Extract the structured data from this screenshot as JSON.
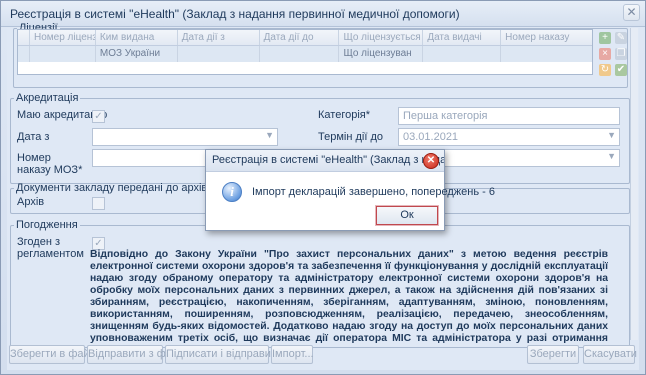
{
  "window": {
    "title": "Реєстрація в системі \"eHealth\" (Заклад з надання первинної медичної допомоги)",
    "close_glyph": "✕"
  },
  "licenses": {
    "legend": "Ліцензії",
    "columns": [
      "",
      "Номер ліцензії",
      "Ким видана",
      "Дата дії з",
      "Дата дії до",
      "Що ліцензується",
      "Дата видачі",
      "Номер наказу"
    ],
    "row": [
      "",
      "",
      "МОЗ України",
      "",
      "",
      "Що ліцензуван",
      "",
      ""
    ],
    "side_icons": [
      "add-icon",
      "edit-icon",
      "delete-icon",
      "copy-icon",
      "refresh-icon",
      "settings-icon"
    ]
  },
  "accreditation": {
    "legend": "Акредитація",
    "has_label": "Маю акредитацію",
    "has_checked": true,
    "category_label": "Категорія*",
    "category_value": "Перша категорія",
    "date_from_label": "Дата з",
    "date_from_value": "",
    "valid_until_label": "Термін дії до",
    "valid_until_value": "03.01.2021",
    "order_label": "Номер наказу МОЗ*",
    "order_value": ""
  },
  "archive": {
    "legend": "Документи закладу передані до архіву",
    "label": "Архів",
    "checked": false
  },
  "agreement": {
    "legend": "Погодження",
    "agree_label": "Згоден з регламентом",
    "agree_checked": true,
    "text": "Відповідно до Закону України \"Про захист персональних даних\" з метою ведення реєстрів електронної системи охорони здоров'я та забезпечення її функціонування у дослідній експлуатації надаю згоду обраному оператору та адміністратору електронної системи охорони здоров'я на обробку моїх персональних даних з первинних джерел, а також на здійснення дій пов'язаних зі збиранням, реєстрацією, накопиченням, зберіганням, адаптуванням, зміною, поновленням, використанням, поширенням, розповсюдженням, реалізацією, передачею, знеособленням, знищенням будь-яких відомостей. Додатково надаю згоду на доступ до моїх персональних даних уповноваженим третіх осіб, що визначає дії оператора МІС та адміністратора у разі отримання запиту від уповноваженої третьої особи щодо надання доступу до персональних даних. Підтверджую достовірність вказаних мною даних та добровільність надання цих даних до електронної системи охорони здоров'я, що працює у дослідній експлуатації. Усвідомлюю, що у випадку надання мною невірної інформації, мені може бути відмовлено в реєстрації в"
  },
  "buttons": {
    "save_file": "Зберегти в файл",
    "send_file": "Відправити з файлу",
    "sign_send": "Підписати і відправити",
    "import": "Імпорт...",
    "save": "Зберегти",
    "cancel": "Скасувати"
  },
  "dialog": {
    "title": "Реєстрація в системі \"eHealth\" (Заклад з надання...",
    "message": "Імпорт декларацій завершено, попереджень - 6",
    "ok": "Ок",
    "icon": "info-icon",
    "close_glyph": "✕"
  }
}
